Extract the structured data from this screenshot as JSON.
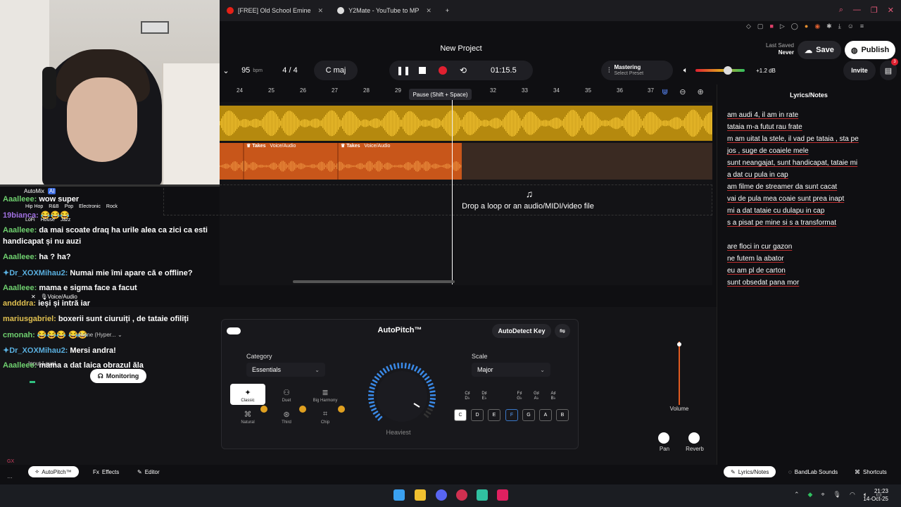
{
  "browser": {
    "tabs": [
      {
        "label": "[FREE] Old School Emine",
        "icon_color": "#e62117"
      },
      {
        "label": "Y2Mate - YouTube to MP",
        "icon_color": "#dddddd"
      }
    ],
    "new_tab": "+"
  },
  "header": {
    "project_title": "New Project",
    "last_saved_label": "Last Saved",
    "last_saved_value": "Never",
    "save_label": "Save",
    "publish_label": "Publish"
  },
  "transport": {
    "tempo": "95",
    "tempo_unit": "bpm",
    "time_signature": "4 / 4",
    "key": "C maj",
    "time": "01:15.5",
    "tooltip": "Pause (Shift + Space)",
    "mastering_label": "Mastering",
    "mastering_sub": "Select Preset",
    "volume_db": "+1.2 dB",
    "invite_label": "Invite",
    "cart_badge": "3"
  },
  "ruler": {
    "ticks": [
      "24",
      "25",
      "26",
      "27",
      "28",
      "29",
      "31",
      "32",
      "33",
      "34",
      "35",
      "36",
      "37"
    ]
  },
  "tracks": {
    "clips": [
      {
        "label": "Takes",
        "type": "Voice/Audio"
      },
      {
        "label": "Takes",
        "type": "Voice/Audio"
      }
    ],
    "drop_text": "Drop a loop or an audio/MIDI/video file"
  },
  "lyrics": {
    "title": "Lyrics/Notes",
    "lines": [
      "am audi 4, il am in rate",
      "tataia m-a futut rau frate",
      "m am uitat la stele, il vad pe tataia , sta pe",
      "jos  , suge de coaiele mele",
      "sunt neangajat, sunt handicapat, tataie mi",
      "a dat cu pula in cap",
      "am filme de streamer da sunt cacat",
      "vai de pula mea coaie sunt prea inapt",
      "mi a dat tataie cu dulapu in cap",
      "s a pisat pe mine si s a transformat",
      "",
      "are floci in cur gazon",
      "ne futem la abator",
      "eu am pl de carton",
      "sunt obsedat pana mor"
    ]
  },
  "chat": {
    "automix": "AutoMix",
    "ai_badge": "AI",
    "genres_row1": [
      "Hip Hop",
      "R&B",
      "Pop",
      "Electronic",
      "Rock"
    ],
    "genres_row2": [
      "LoFi",
      "House",
      "Jazz"
    ],
    "messages": [
      {
        "user": "Aaalleee:",
        "text": "wow super",
        "color": "#6fd06f"
      },
      {
        "user": "19bianca:",
        "text": "😂😂😂",
        "color": "#a070e0"
      },
      {
        "user": "Aaalleee:",
        "text": "da mai scoate draq ha urile alea ca zici ca esti",
        "color": "#6fd06f"
      },
      {
        "user": "",
        "text": "handicapat și nu auzi",
        "color": "#ffffff"
      },
      {
        "user": "Aaalleee:",
        "text": "ha ? ha?",
        "color": "#6fd06f"
      },
      {
        "user": "Dr_XOXMihau2:",
        "text": "Numai mie îmi apare că e offline?",
        "color": "#5ab0e0"
      },
      {
        "user": "Aaalleee:",
        "text": "mama e sigma face a facut",
        "color": "#6fd06f"
      },
      {
        "user": "andddra:",
        "text": "ieși și intră iar",
        "color": "#e0c050"
      },
      {
        "user": "mariusgabriel:",
        "text": "boxerii sunt ciuruiți , de tataie ofiliți",
        "color": "#e0c050"
      },
      {
        "user": "cmonah:",
        "text": "😂😂😂 😂😂",
        "color": "#6fd06f"
      },
      {
        "user": "Dr_XOXMihau2:",
        "text": "Mersi andra!",
        "color": "#5ab0e0"
      },
      {
        "user": "Aaalleee:",
        "text": "mama a dat laica obrazul ăla",
        "color": "#6fd06f"
      }
    ],
    "voice_audio": "Voice/Audio",
    "mic_partial": "phone (Hyper...",
    "input_level": "Input Level",
    "monitoring": "Monitoring"
  },
  "autopitch": {
    "title": "AutoPitch™",
    "autodetect_label": "AutoDetect Key",
    "category_label": "Category",
    "category_value": "Essentials",
    "scale_label": "Scale",
    "scale_value": "Major",
    "modes": [
      "Classic",
      "Duet",
      "Big Harmony",
      "Natural",
      "Third",
      "Chip"
    ],
    "knob_label": "Heaviest",
    "sharps": [
      "C#\nDb",
      "D#\nEb",
      "F#\nGb",
      "G#\nAb",
      "A#\nBb"
    ],
    "keys": [
      "C",
      "D",
      "E",
      "F",
      "G",
      "A",
      "B"
    ]
  },
  "mixer": {
    "volume_label": "Volume",
    "pan_label": "Pan",
    "reverb_label": "Reverb"
  },
  "bottom_tabs": {
    "autopitch": "AutoPitch™",
    "effects": "Effects",
    "editor": "Editor",
    "lyrics": "Lyrics/Notes",
    "sounds": "BandLab Sounds",
    "shortcuts": "Shortcuts"
  },
  "taskbar": {
    "time": "21:23",
    "date": "14-Oct-25"
  }
}
